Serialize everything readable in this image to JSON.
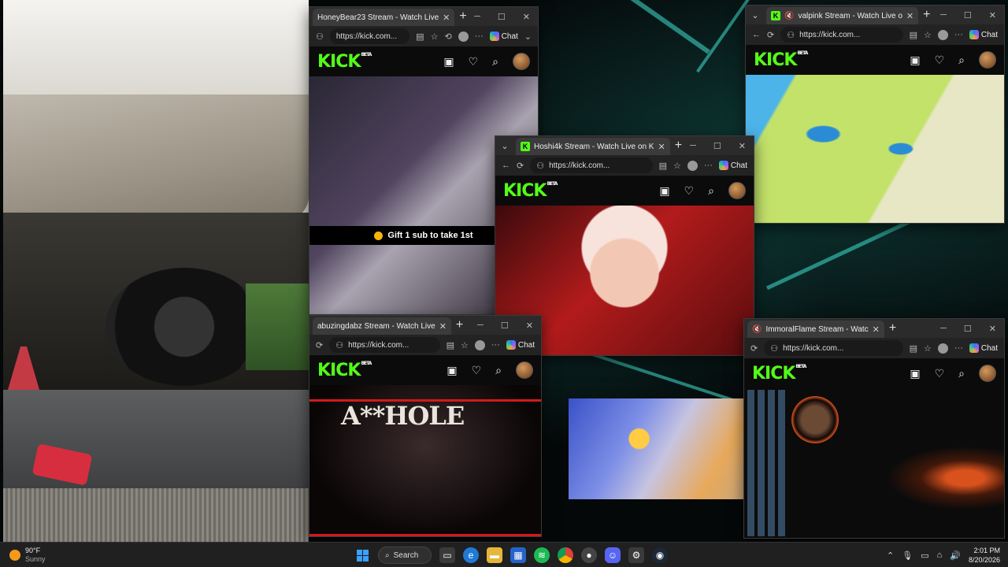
{
  "colors": {
    "kick_green": "#53fc18",
    "titlebar": "#2b2b2b",
    "taskbar": "#202020",
    "accent_red": "#d11a1a"
  },
  "common": {
    "url": "https://kick.com...",
    "chat_label": "Chat",
    "kick_logo": "KICK",
    "kick_beta": "BETA"
  },
  "windows": {
    "honeybear": {
      "tab_title": "HoneyBear23 Stream - Watch Live",
      "gift_text": "Gift 1 sub to take 1st"
    },
    "hoshi": {
      "tab_title": "Hoshi4k Stream - Watch Live on K"
    },
    "valpink": {
      "tab_title": "valpink Stream - Watch Live o"
    },
    "abuz": {
      "tab_title": "abuzingdabz Stream - Watch Live",
      "poster_text": "A**HOLE"
    },
    "immoral": {
      "tab_title": "ImmoralFlame Stream - Watc"
    }
  },
  "taskbar": {
    "temperature": "90°F",
    "condition": "Sunny",
    "search_label": "Search",
    "time": "2:01 PM",
    "date": "8/20/2026"
  }
}
